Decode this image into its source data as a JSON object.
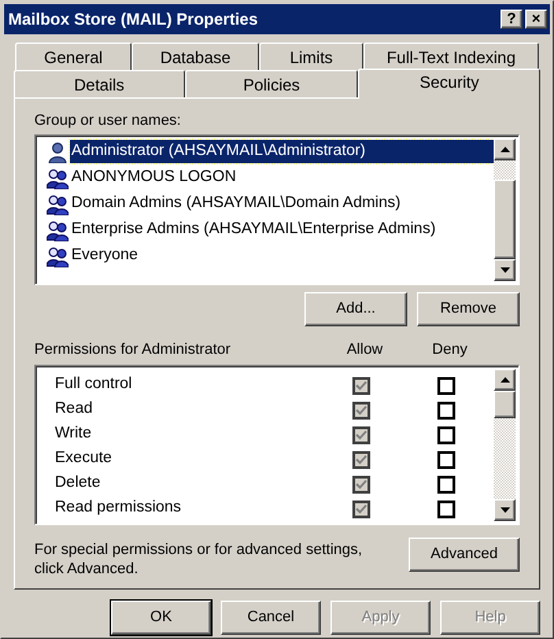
{
  "window": {
    "title": "Mailbox Store (MAIL) Properties",
    "title_buttons": [
      "?",
      "×"
    ]
  },
  "tab_rows": [
    [
      {
        "label": "General",
        "selected": false
      },
      {
        "label": "Database",
        "selected": false
      },
      {
        "label": "Limits",
        "selected": false
      },
      {
        "label": "Full-Text Indexing",
        "selected": false
      }
    ],
    [
      {
        "label": "Details",
        "selected": false
      },
      {
        "label": "Policies",
        "selected": false
      },
      {
        "label": "Security",
        "selected": true
      }
    ]
  ],
  "group_label": {
    "text": "Group or user names:"
  },
  "principals": [
    {
      "name": "Administrator (AHSAYMAIL\\Administrator)",
      "kind": "user",
      "selected": true
    },
    {
      "name": "ANONYMOUS LOGON",
      "kind": "group",
      "selected": false
    },
    {
      "name": "Domain Admins (AHSAYMAIL\\Domain Admins)",
      "kind": "group",
      "selected": false
    },
    {
      "name": "Enterprise Admins (AHSAYMAIL\\Enterprise Admins)",
      "kind": "group",
      "selected": false
    },
    {
      "name": "Everyone",
      "kind": "group",
      "selected": false
    }
  ],
  "principal_buttons": [
    {
      "label": "Add..."
    },
    {
      "label": "Remove"
    }
  ],
  "permissions_label": {
    "text": "Permissions for Administrator"
  },
  "permission_columns": [
    "Allow",
    "Deny"
  ],
  "permissions": [
    {
      "name": "Full control",
      "allow": true,
      "deny": false
    },
    {
      "name": "Read",
      "allow": true,
      "deny": false
    },
    {
      "name": "Write",
      "allow": true,
      "deny": false
    },
    {
      "name": "Execute",
      "allow": true,
      "deny": false
    },
    {
      "name": "Delete",
      "allow": true,
      "deny": false
    },
    {
      "name": "Read permissions",
      "allow": true,
      "deny": false
    }
  ],
  "advanced_note": "For special permissions or for advanced settings, click Advanced.",
  "advanced_button": {
    "label": "Advanced"
  },
  "footer_buttons": [
    {
      "label": "OK",
      "disabled": false,
      "default": true
    },
    {
      "label": "Cancel",
      "disabled": false,
      "default": false
    },
    {
      "label": "Apply",
      "disabled": true,
      "default": false
    },
    {
      "label": "Help",
      "disabled": true,
      "default": false
    }
  ]
}
